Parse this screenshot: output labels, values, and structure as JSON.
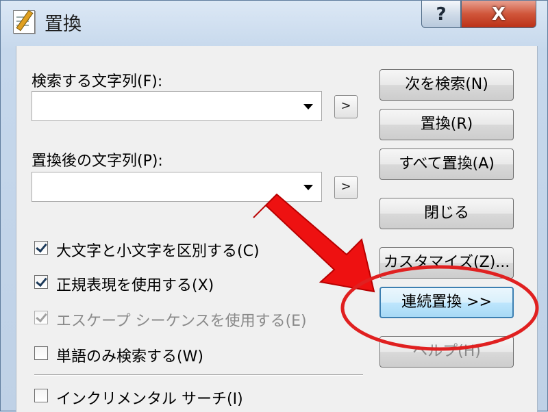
{
  "window": {
    "title": "置換",
    "help_label": "?",
    "close_label": "X"
  },
  "find": {
    "label": "検索する文字列(F):",
    "value": "",
    "more_label": ">"
  },
  "replace": {
    "label": "置換後の文字列(P):",
    "value": "",
    "more_label": ">"
  },
  "buttons": {
    "find_next": "次を検索(N)",
    "replace": "置換(R)",
    "replace_all": "すべて置換(A)",
    "close": "閉じる",
    "customize": "カスタマイズ(Z)...",
    "continuous_replace": "連続置換 >>",
    "help": "ヘルプ(H)"
  },
  "options": [
    {
      "label": "大文字と小文字を区別する(C)",
      "checked": true,
      "enabled": true
    },
    {
      "label": "正規表現を使用する(X)",
      "checked": true,
      "enabled": true
    },
    {
      "label": "エスケープ シーケンスを使用する(E)",
      "checked": true,
      "enabled": false
    },
    {
      "label": "単語のみ検索する(W)",
      "checked": false,
      "enabled": true
    },
    {
      "label": "インクリメンタル サーチ(I)",
      "checked": false,
      "enabled": true
    }
  ],
  "annotation": {
    "arrow_color": "#ee1111",
    "circle_color": "#e02020"
  }
}
